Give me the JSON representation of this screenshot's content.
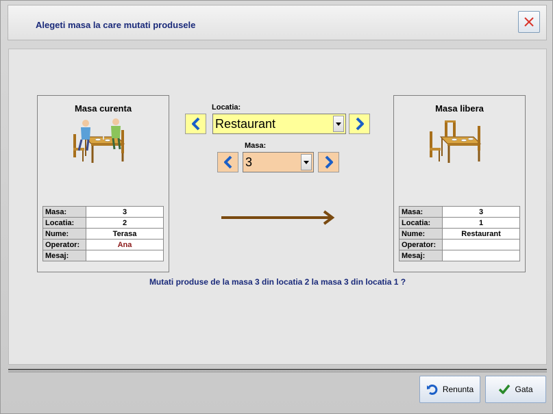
{
  "window": {
    "title": "Alegeti masa la care mutati produsele"
  },
  "current_table": {
    "title": "Masa curenta",
    "rows": [
      {
        "label": "Masa:",
        "value": "3"
      },
      {
        "label": "Locatia:",
        "value": "2"
      },
      {
        "label": "Nume:",
        "value": "Terasa"
      },
      {
        "label": "Operator:",
        "value": "Ana"
      },
      {
        "label": "Mesaj:",
        "value": ""
      }
    ]
  },
  "free_table": {
    "title": "Masa libera",
    "rows": [
      {
        "label": "Masa:",
        "value": "3"
      },
      {
        "label": "Locatia:",
        "value": "1"
      },
      {
        "label": "Nume:",
        "value": "Restaurant"
      },
      {
        "label": "Operator:",
        "value": ""
      },
      {
        "label": "Mesaj:",
        "value": ""
      }
    ]
  },
  "location": {
    "label": "Locatia:",
    "selected": "Restaurant"
  },
  "table": {
    "label": "Masa:",
    "selected": "3"
  },
  "question": "Mutati produse de la masa 3 din locatia 2 la masa 3 din locatia 1 ?",
  "buttons": {
    "cancel": "Renunta",
    "done": "Gata"
  },
  "colors": {
    "accent": "#1a2a7a",
    "arrow": "#7a4a10",
    "location_bg": "#ffff99",
    "table_bg": "#f7cfa5"
  }
}
